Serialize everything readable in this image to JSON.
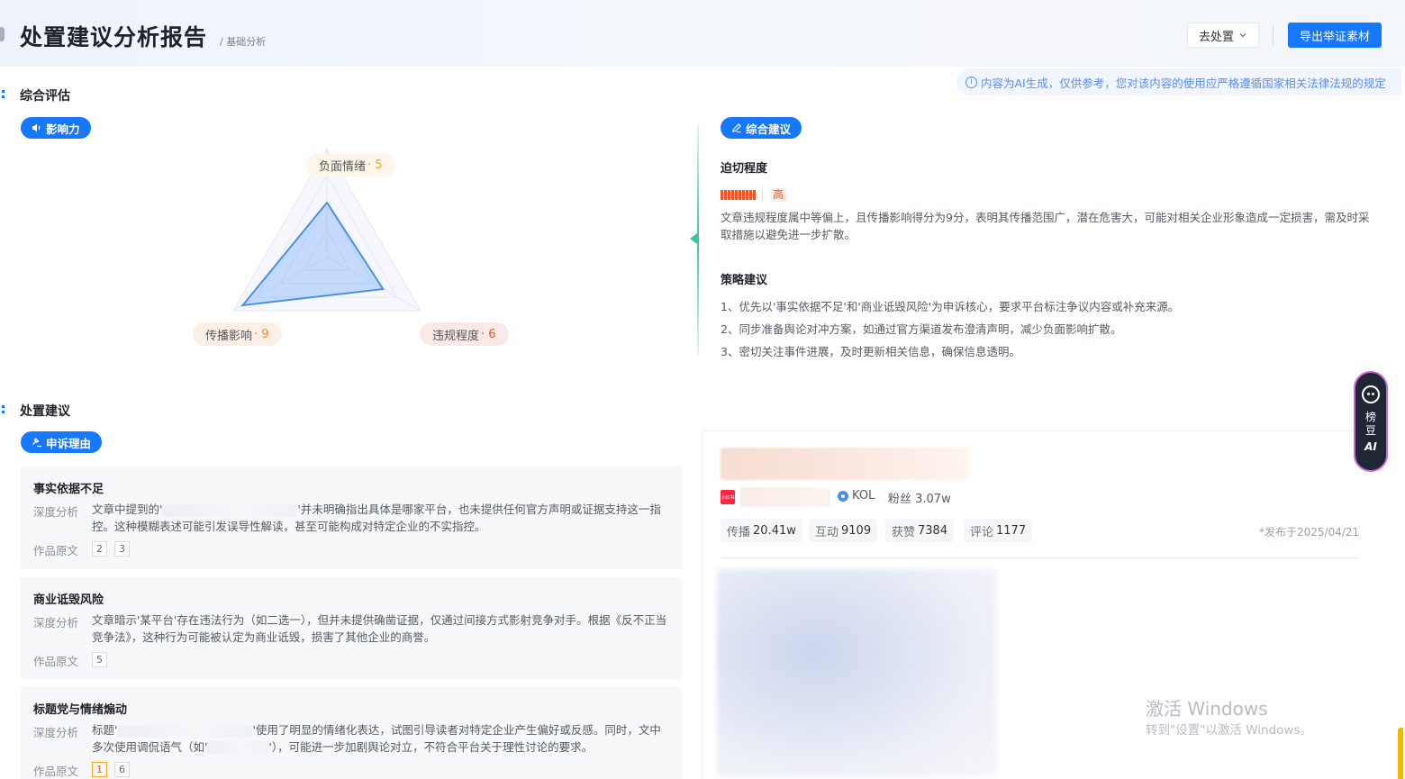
{
  "header": {
    "title": "处置建议分析报告",
    "breadcrumb": "/ 基础分析",
    "status_select": "去处置",
    "export_button": "导出举证素材"
  },
  "ai_notice": "内容为AI生成，仅供参考，您对该内容的使用应严格遵循国家相关法律法规的规定",
  "overall": {
    "section_title": "综合评估",
    "influence_pill": "影响力",
    "radar": {
      "negative_label": "负面情绪",
      "negative_score": "5",
      "spread_label": "传播影响",
      "spread_score": "9",
      "violation_label": "违规程度",
      "violation_score": "6",
      "max": 10
    },
    "advice_pill": "综合建议",
    "urgency_title": "迫切程度",
    "urgency_level": "高",
    "urgency_text": "文章违规程度属中等偏上，且传播影响得分为9分，表明其传播范围广，潜在危害大，可能对相关企业形象造成一定损害，需及时采取措施以避免进一步扩散。",
    "strategy_title": "策略建议",
    "strategies": [
      "1、优先以'事实依据不足'和'商业诋毁风险'为申诉核心，要求平台标注争议内容或补充来源。",
      "2、同步准备舆论对冲方案，如通过官方渠道发布澄清声明，减少负面影响扩散。",
      "3、密切关注事件进展，及时更新相关信息，确保信息透明。"
    ]
  },
  "disposal": {
    "section_title": "处置建议",
    "appeal_pill": "申诉理由",
    "cards": [
      {
        "title": "事实依据不足",
        "analysis_label": "深度分析",
        "text_pre": "文章中提到的'",
        "text_post": "'并未明确指出具体是哪家平台，也未提供任何官方声明或证据支持这一指控。这种模糊表述可能引发误导性解读，甚至可能构成对特定企业的不实指控。",
        "source_label": "作品原文",
        "refs": [
          "2",
          "3"
        ]
      },
      {
        "title": "商业诋毁风险",
        "analysis_label": "深度分析",
        "text": "文章暗示'某平台'存在违法行为（如二选一），但并未提供确凿证据，仅通过间接方式影射竞争对手。根据《反不正当竞争法》，这种行为可能被认定为商业诋毁，损害了其他企业的商誉。",
        "source_label": "作品原文",
        "refs": [
          "5"
        ]
      },
      {
        "title": "标题党与情绪煽动",
        "analysis_label": "深度分析",
        "text_a": "标题'",
        "text_b": "'使用了明显的情绪化表达，试图引导读者对特定企业产生偏好或反感。同时，文中多次使用调侃语气（如'",
        "text_c": "'），可能进一步加剧舆论对立，不符合平台关于理性讨论的要求。",
        "source_label": "作品原文",
        "refs": [
          "1",
          "6"
        ]
      }
    ]
  },
  "post": {
    "platform": "小红书",
    "kol": "KOL",
    "fans": "粉丝 3.07w",
    "stats": [
      {
        "label": "传播",
        "value": "20.41w"
      },
      {
        "label": "互动",
        "value": "9109"
      },
      {
        "label": "获赞",
        "value": "7384"
      },
      {
        "label": "评论",
        "value": "1177"
      }
    ],
    "published": "*发布于2025/04/21"
  },
  "ai_assistant": {
    "name": "榜豆",
    "badge": "AI"
  },
  "watermark": {
    "line1": "激活 Windows",
    "line2": "转到\"设置\"以激活 Windows。"
  },
  "colors": {
    "primary": "#1677ff",
    "danger": "#e8562a",
    "warning": "#f5a623",
    "accent_teal": "#36c6a6"
  }
}
